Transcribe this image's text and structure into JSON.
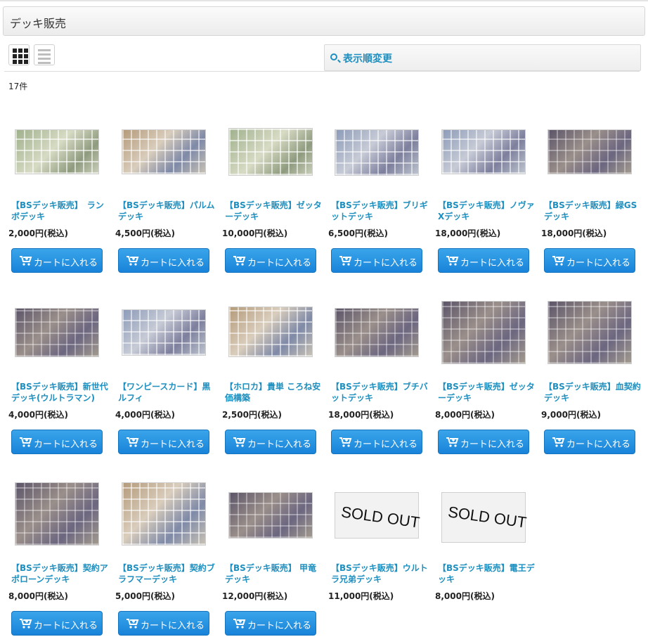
{
  "page": {
    "title": "デッキ販売",
    "count": "17件",
    "sort_label": "表示順変更"
  },
  "icons": {
    "grid_view": "grid-view-icon",
    "list_view": "list-view-icon",
    "sort": "search-zoom-icon",
    "cart": "cart-icon"
  },
  "colors": {
    "link": "#1e8fbf",
    "button": "#1e8fe0"
  },
  "cart_button_label": "カートに入れる",
  "sold_out_label": "SOLD OUT",
  "products": [
    {
      "name": "【BSデッキ販売】　ランボデッキ",
      "price": "2,000円(税込)"
    },
    {
      "name": "【BSデッキ販売】パルムデッキ",
      "price": "4,500円(税込)"
    },
    {
      "name": "【BSデッキ販売】ゼッターデッキ",
      "price": "10,000円(税込)"
    },
    {
      "name": "【BSデッキ販売】ブリギットデッキ",
      "price": "6,500円(税込)"
    },
    {
      "name": "【BSデッキ販売】ノヴァXデッキ",
      "price": "18,000円(税込)"
    },
    {
      "name": "【BSデッキ販売】緑GSデッキ",
      "price": "18,000円(税込)"
    },
    {
      "name": "【BSデッキ販売】新世代デッキ(ウルトラマン)",
      "price": "4,000円(税込)"
    },
    {
      "name": "【ワンピースカード】黒ルフィ",
      "price": "4,000円(税込)"
    },
    {
      "name": "【ホロカ】貴単 ころね安価構築",
      "price": "2,500円(税込)"
    },
    {
      "name": "【BSデッキ販売】ブチバットデッキ",
      "price": "18,000円(税込)"
    },
    {
      "name": "【BSデッキ販売】ゼッターデッキ",
      "price": "8,000円(税込)"
    },
    {
      "name": "【BSデッキ販売】血契約デッキ",
      "price": "9,000円(税込)"
    },
    {
      "name": "【BSデッキ販売】契約アポローンデッキ",
      "price": "8,000円(税込)"
    },
    {
      "name": "【BSデッキ販売】契約ブラフマーデッキ",
      "price": "5,000円(税込)"
    },
    {
      "name": "【BSデッキ販売】 甲竜デッキ",
      "price": "12,000円(税込)"
    },
    {
      "name": "【BSデッキ販売】ウルトラ兄弟デッキ",
      "price": "11,000円(税込)",
      "sold_out": true
    },
    {
      "name": "【BSデッキ販売】電王デッキ",
      "price": "8,000円(税込)",
      "sold_out": true
    }
  ]
}
